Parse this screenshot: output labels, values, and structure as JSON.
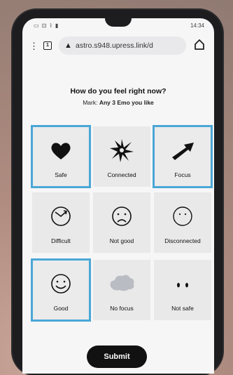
{
  "status": {
    "left": "▭ ⊡ ⌇ ▮",
    "time": "14:34"
  },
  "browser": {
    "url": "astro.s948.upress.link/d",
    "tab_count": "1"
  },
  "prompt": {
    "title": "How do you feel right now?",
    "mark_prefix": "Mark:",
    "mark_text": "Any 3 Emo you like"
  },
  "cells": [
    {
      "label": "Safe",
      "icon": "heart-icon",
      "selected": true
    },
    {
      "label": "Connected",
      "icon": "star-burst-icon",
      "selected": false
    },
    {
      "label": "Focus",
      "icon": "arrow-icon",
      "selected": true
    },
    {
      "label": "Difficult",
      "icon": "clock-face-icon",
      "selected": false
    },
    {
      "label": "Not good",
      "icon": "sad-face-icon",
      "selected": false
    },
    {
      "label": "Disconnected",
      "icon": "neutral-face-icon",
      "selected": false
    },
    {
      "label": "Good",
      "icon": "smile-face-icon",
      "selected": true
    },
    {
      "label": "No focus",
      "icon": "cloud-icon",
      "selected": false
    },
    {
      "label": "Not safe",
      "icon": "eyes-icon",
      "selected": false
    }
  ],
  "submit_label": "Submit",
  "colors": {
    "selection": "#4aa7d6",
    "button": "#111111"
  }
}
